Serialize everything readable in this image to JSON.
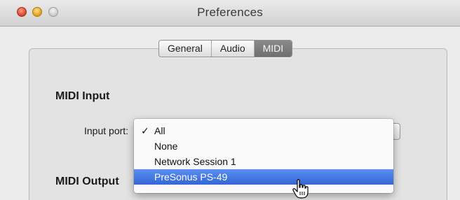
{
  "window": {
    "title": "Preferences"
  },
  "tabs": [
    {
      "label": "General",
      "selected": false
    },
    {
      "label": "Audio",
      "selected": false
    },
    {
      "label": "MIDI",
      "selected": true
    }
  ],
  "midi_input": {
    "section_title": "MIDI Input",
    "port_label": "Input port:"
  },
  "midi_output": {
    "section_title": "MIDI Output"
  },
  "dropdown_menu": {
    "items": [
      {
        "label": "All",
        "checked": true,
        "highlighted": false
      },
      {
        "label": "None",
        "checked": false,
        "highlighted": false
      },
      {
        "label": "Network Session 1",
        "checked": false,
        "highlighted": false
      },
      {
        "label": "PreSonus PS-49",
        "checked": false,
        "highlighted": true
      }
    ],
    "check_glyph": "✓"
  },
  "colors": {
    "selection_highlight": "#3a6fdc",
    "selected_tab": "#7b7b7b"
  },
  "icons": {
    "pointer": "hand-pointer-icon"
  }
}
